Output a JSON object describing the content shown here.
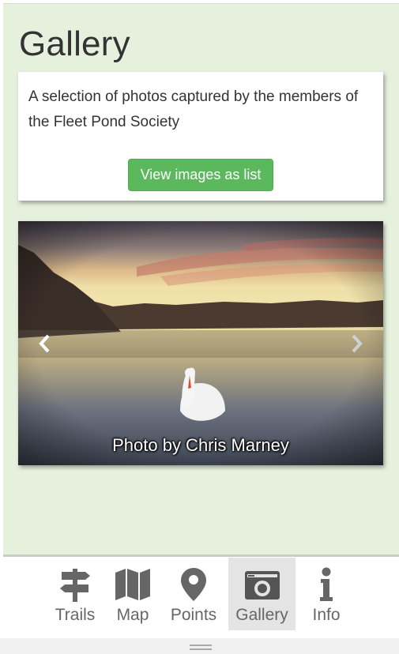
{
  "page": {
    "title": "Gallery",
    "description": "A selection of photos captured by the members of the Fleet Pond Society",
    "list_button": "View images as list"
  },
  "carousel": {
    "caption": "Photo by Chris Marney",
    "prev_icon": "chevron-left-icon",
    "next_icon": "chevron-right-icon"
  },
  "tabs": [
    {
      "label": "Trails",
      "icon": "signpost-icon",
      "active": false
    },
    {
      "label": "Map",
      "icon": "map-icon",
      "active": false
    },
    {
      "label": "Points",
      "icon": "map-marker-icon",
      "active": false
    },
    {
      "label": "Gallery",
      "icon": "camera-icon",
      "active": true
    },
    {
      "label": "Info",
      "icon": "info-icon",
      "active": false
    }
  ],
  "colors": {
    "background": "#e6f1dd",
    "button": "#5cb85c",
    "tab_icon": "#666666",
    "active_tab": "#e4e4e4"
  }
}
